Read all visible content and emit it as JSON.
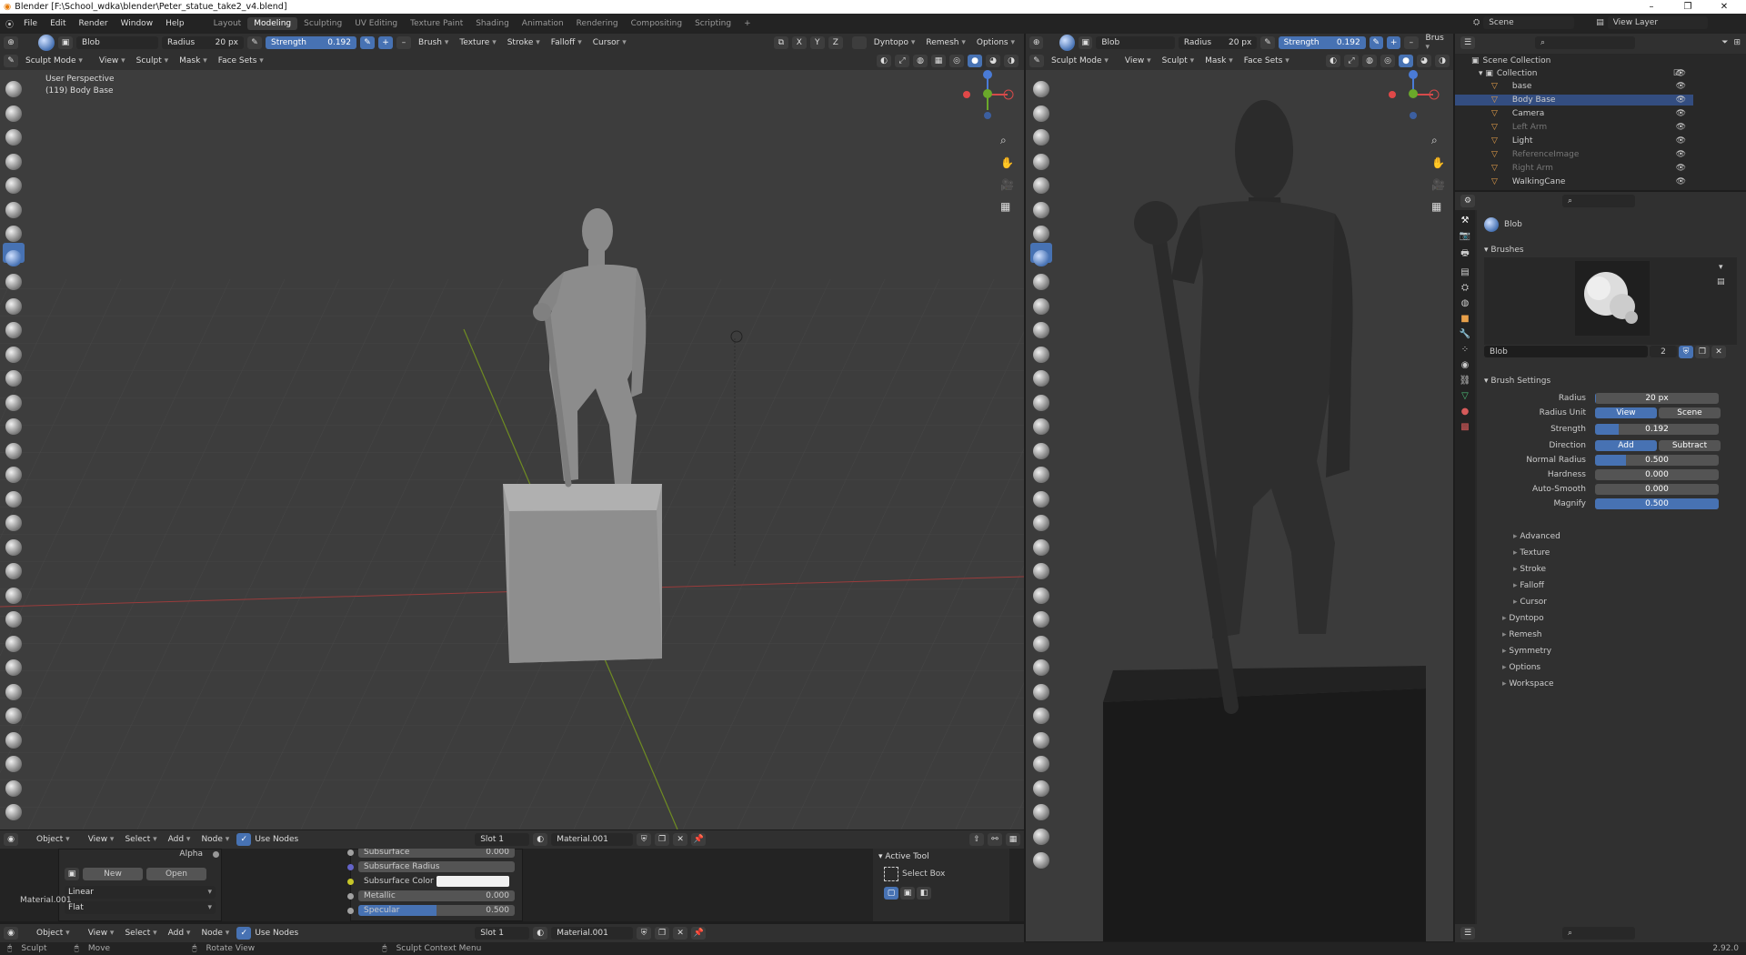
{
  "window_title": "Blender [F:\\School_wdka\\blender\\Peter_statue_take2_v4.blend]",
  "menu": [
    "File",
    "Edit",
    "Render",
    "Window",
    "Help"
  ],
  "workspaces": [
    "Layout",
    "Modeling",
    "Sculpting",
    "UV Editing",
    "Texture Paint",
    "Shading",
    "Animation",
    "Rendering",
    "Compositing",
    "Scripting"
  ],
  "active_workspace": "Modeling",
  "scene": "Scene",
  "view_layer": "View Layer",
  "left_tool_header": {
    "brush": "Blob",
    "radius_label": "Radius",
    "radius_val": "20 px",
    "strength_label": "Strength",
    "strength_val": "0.192",
    "brush_menu": "Brush",
    "texture_menu": "Texture",
    "stroke_menu": "Stroke",
    "falloff_menu": "Falloff",
    "cursor_menu": "Cursor",
    "axes": [
      "X",
      "Y",
      "Z"
    ],
    "dyntopo": "Dyntopo",
    "remesh": "Remesh",
    "options": "Options"
  },
  "right_tool_header": {
    "brush": "Blob",
    "radius_label": "Radius",
    "radius_val": "20 px",
    "strength_label": "Strength",
    "strength_val": "0.192",
    "brush_menu": "Brus"
  },
  "viewport_header": {
    "mode": "Sculpt Mode",
    "items": [
      "View",
      "Sculpt",
      "Mask",
      "Face Sets"
    ]
  },
  "viewport_overlay": {
    "line1": "User Perspective",
    "line2": "(119) Body Base"
  },
  "outliner": {
    "title": "Scene Collection",
    "collection": "Collection",
    "items": [
      {
        "name": "base",
        "selected": false,
        "dim": false
      },
      {
        "name": "Body Base",
        "selected": true,
        "dim": false
      },
      {
        "name": "Camera",
        "selected": false,
        "dim": false
      },
      {
        "name": "Left Arm",
        "selected": false,
        "dim": true
      },
      {
        "name": "Light",
        "selected": false,
        "dim": false
      },
      {
        "name": "ReferenceImage",
        "selected": false,
        "dim": true
      },
      {
        "name": "Right Arm",
        "selected": false,
        "dim": true
      },
      {
        "name": "WalkingCane",
        "selected": false,
        "dim": false
      }
    ]
  },
  "properties": {
    "tool_name": "Blob",
    "brushes_label": "Brushes",
    "brush_name": "Blob",
    "brush_users": "2",
    "brush_settings_label": "Brush Settings",
    "radius": {
      "label": "Radius",
      "value": "20 px",
      "fill": 0.01
    },
    "radius_unit": {
      "label": "Radius Unit",
      "opt1": "View",
      "opt2": "Scene"
    },
    "strength": {
      "label": "Strength",
      "value": "0.192",
      "fill": 0.19
    },
    "direction": {
      "label": "Direction",
      "opt1": "Add",
      "opt2": "Subtract"
    },
    "normal_radius": {
      "label": "Normal Radius",
      "value": "0.500",
      "fill": 0.25
    },
    "hardness": {
      "label": "Hardness",
      "value": "0.000",
      "fill": 0
    },
    "auto_smooth": {
      "label": "Auto-Smooth",
      "value": "0.000",
      "fill": 0
    },
    "magnify": {
      "label": "Magnify",
      "value": "0.500",
      "fill": 1.0
    },
    "subpanels": [
      "Advanced",
      "Texture",
      "Stroke",
      "Falloff",
      "Cursor"
    ],
    "sections": [
      "Dyntopo",
      "Remesh",
      "Symmetry",
      "Options",
      "Workspace"
    ]
  },
  "node_editor": {
    "object_menu": "Object",
    "items": [
      "View",
      "Select",
      "Add",
      "Node"
    ],
    "use_nodes": "Use Nodes",
    "slot": "Slot 1",
    "material": "Material.001",
    "alpha": "Alpha",
    "new": "New",
    "open": "Open",
    "interp": "Linear",
    "proj": "Flat",
    "material_label": "Material.001",
    "sockets": [
      {
        "label": "Subsurface",
        "value": "0.000"
      },
      {
        "label": "Subsurface Radius",
        "value": ""
      },
      {
        "label": "Subsurface Color",
        "value": ""
      },
      {
        "label": "Metallic",
        "value": "0.000"
      },
      {
        "label": "Specular",
        "value": "0.500"
      }
    ],
    "active_tool": "Active Tool",
    "select_box": "Select Box"
  },
  "statusbar": {
    "sculpt": "Sculpt",
    "move": "Move",
    "rotate": "Rotate View",
    "context": "Sculpt Context Menu",
    "version": "2.92.0"
  },
  "colors": {
    "accent": "#4772b3",
    "bg": "#1d1d1d",
    "header": "#303030",
    "viewport": "#3d3d3d"
  }
}
